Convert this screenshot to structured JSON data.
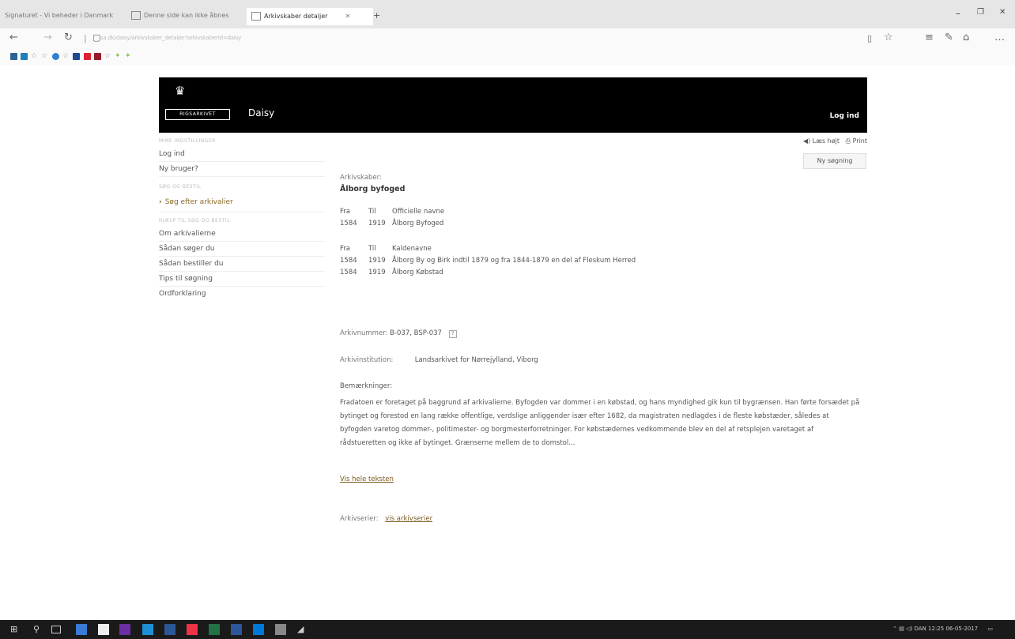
{
  "browser": {
    "tabs": [
      "Signaturet - Vi beheder i Danmark",
      "Denne side kan ikke åbnes",
      "Arkivskaber detaljer"
    ],
    "new_tab": "+",
    "address": "sa.dk/daisy/arkivskaber_detaljer?arkivskaberId=daisy"
  },
  "header": {
    "logo_text": "RIGSARKIVET",
    "app_name": "Daisy",
    "login": "Log ind"
  },
  "sidebar": {
    "section1": "MINE INDSTILLINGER",
    "items1": [
      "Log ind",
      "Ny bruger?"
    ],
    "section2": "SØG OG BESTIL",
    "search_item": "Søg efter arkivalier",
    "section3": "HJÆLP TIL SØG OG BESTIL",
    "items3": [
      "Om arkivalierne",
      "Sådan søger du",
      "Sådan bestiller du",
      "Tips til søgning",
      "Ordforklaring"
    ]
  },
  "tools": {
    "read_aloud": "Læs højt",
    "print": "Print",
    "new_search": "Ny søgning"
  },
  "main": {
    "creator_label": "Arkivskaber:",
    "creator_name": "Ålborg byfoged",
    "official_names": {
      "header": [
        "Fra",
        "Til",
        "Officielle navne"
      ],
      "rows": [
        [
          "1584",
          "1919",
          "Ålborg Byfoged"
        ]
      ]
    },
    "call_names": {
      "header": [
        "Fra",
        "Til",
        "Kaldenavne"
      ],
      "rows": [
        [
          "1584",
          "1919",
          "Ålborg By og Birk indtil 1879 og fra 1844-1879 en del af Fleskum Herred"
        ],
        [
          "1584",
          "1919",
          "Ålborg Købstad"
        ]
      ]
    },
    "archive_number_label": "Arkivnummer:",
    "archive_number": "B-037, BSP-037",
    "help": "?",
    "institution_label": "Arkivinstitution:",
    "institution": "Landsarkivet for Nørrejylland, Viborg",
    "remarks_label": "Bemærkninger:",
    "remarks": "Fradatoen er foretaget på baggrund af arkivalierne. Byfogden var dommer i en købstad, og hans myndighed gik kun til bygrænsen. Han førte forsædet på bytinget og forestod en lang række offentlige, verdslige anliggender især efter 1682, da magistraten nedlagdes i de fleste købstæder, således at byfogden varetog dommer-, politimester- og borgmesterforretninger. For købstædernes vedkommende blev en del af retsplejen varetaget af rådstueretten og ikke af bytinget. Grænserne mellem de to domstol...",
    "show_full": "Vis hele teksten",
    "series_label": "Arkivserier:",
    "series_link": "vis arkivserier"
  },
  "taskbar": {
    "time": "12:25",
    "date": "06-05-2017",
    "lang": "DAN"
  }
}
